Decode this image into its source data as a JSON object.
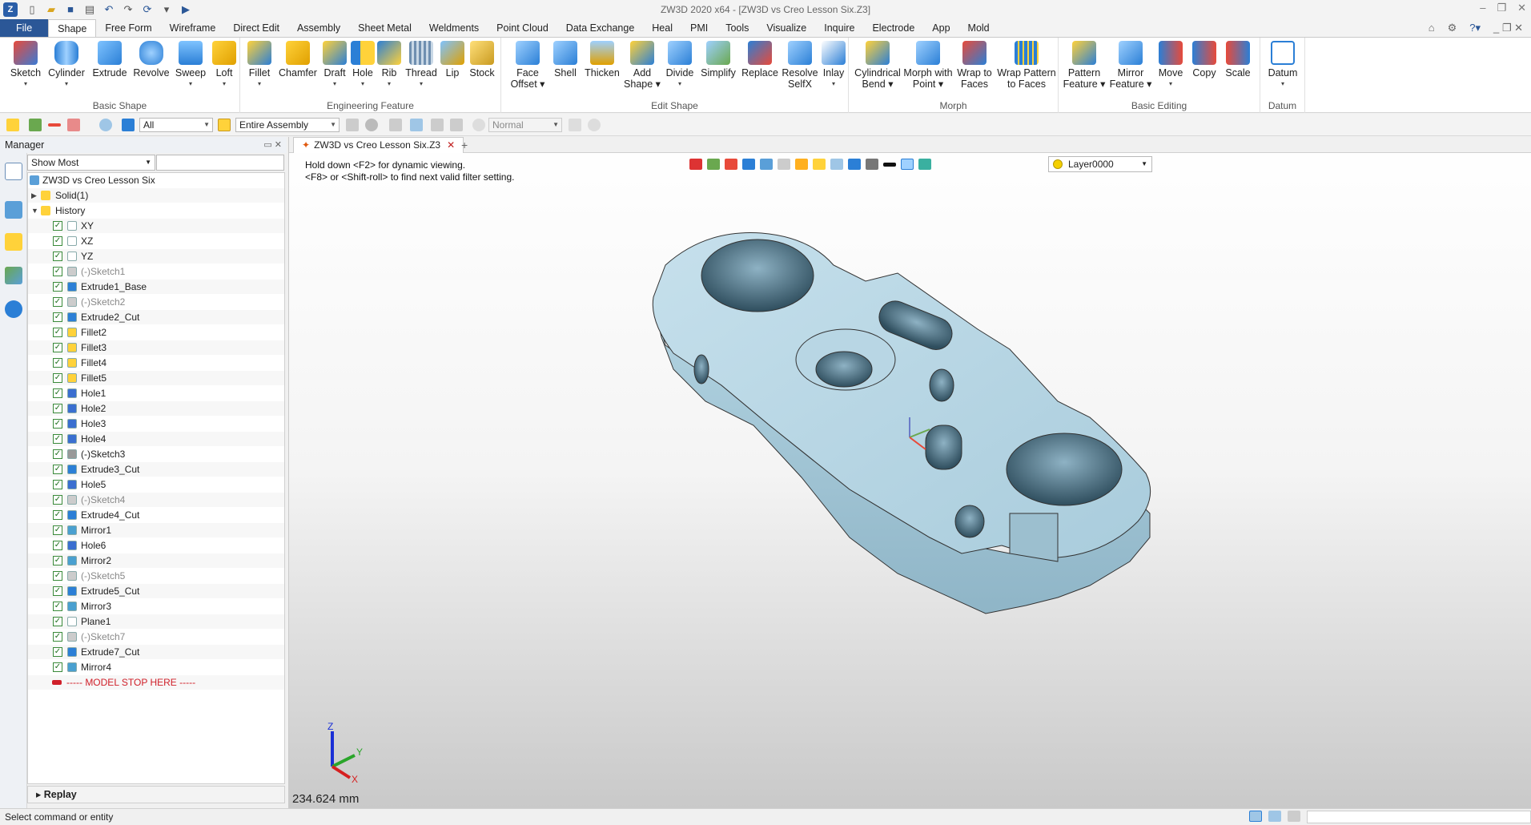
{
  "window": {
    "title": "ZW3D 2020 x64 - [ZW3D vs Creo Lesson Six.Z3]"
  },
  "menu": {
    "tabs": [
      "File",
      "Shape",
      "Free Form",
      "Wireframe",
      "Direct Edit",
      "Assembly",
      "Sheet Metal",
      "Weldments",
      "Point Cloud",
      "Data Exchange",
      "Heal",
      "PMI",
      "Tools",
      "Visualize",
      "Inquire",
      "Electrode",
      "App",
      "Mold"
    ],
    "active": "Shape"
  },
  "ribbon": {
    "groups": [
      "Basic Shape",
      "Engineering Feature",
      "Edit Shape",
      "Morph",
      "Basic Editing",
      "Datum"
    ],
    "basic_shape": [
      "Sketch",
      "Cylinder",
      "Extrude",
      "Revolve",
      "Sweep",
      "Loft"
    ],
    "engineering": [
      "Fillet",
      "Chamfer",
      "Draft",
      "Hole",
      "Rib",
      "Thread",
      "Lip",
      "Stock"
    ],
    "edit_shape": [
      "Face",
      "Offset",
      "Shell",
      "Thicken",
      "Add",
      "Shape",
      "Divide",
      "Simplify",
      "Replace",
      "Resolve",
      "SelfX",
      "Inlay"
    ],
    "morph": [
      "Cylindrical",
      "Bend",
      "Morph with",
      "Point",
      "Wrap to",
      "Faces",
      "Wrap Pattern",
      "to Faces"
    ],
    "basic_editing": [
      "Pattern",
      "Feature",
      "Mirror",
      "Feature",
      "Move",
      "Copy",
      "Scale"
    ],
    "datum": [
      "Datum"
    ]
  },
  "toolbar2": {
    "filter": "All",
    "scope": "Entire Assembly",
    "mode": "Normal"
  },
  "manager": {
    "title": "Manager",
    "filter": "Show Most",
    "root": "ZW3D vs Creo Lesson Six",
    "solid": "Solid(1)",
    "history": "History",
    "items": [
      "XY",
      "XZ",
      "YZ",
      "(-)Sketch1",
      "Extrude1_Base",
      "(-)Sketch2",
      "Extrude2_Cut",
      "Fillet2",
      "Fillet3",
      "Fillet4",
      "Fillet5",
      "Hole1",
      "Hole2",
      "Hole3",
      "Hole4",
      "(-)Sketch3",
      "Extrude3_Cut",
      "Hole5",
      "(-)Sketch4",
      "Extrude4_Cut",
      "Mirror1",
      "Hole6",
      "Mirror2",
      "(-)Sketch5",
      "Extrude5_Cut",
      "Mirror3",
      "Plane1",
      "(-)Sketch7",
      "Extrude7_Cut",
      "Mirror4"
    ],
    "stop": "----- MODEL STOP HERE -----",
    "replay": "Replay"
  },
  "doc": {
    "tab": "ZW3D vs Creo Lesson Six.Z3",
    "hint1": "Hold down <F2> for dynamic viewing.",
    "hint2": "<F8> or <Shift-roll> to find next valid filter setting.",
    "layer": "Layer0000",
    "scale": "234.624 mm"
  },
  "triad": {
    "z": "Z",
    "y": "Y",
    "x": "X"
  },
  "status": {
    "text": "Select command or entity"
  },
  "colors": {
    "accent": "#2b5797",
    "model": "#b8d8e6",
    "stop": "#d0202a"
  }
}
